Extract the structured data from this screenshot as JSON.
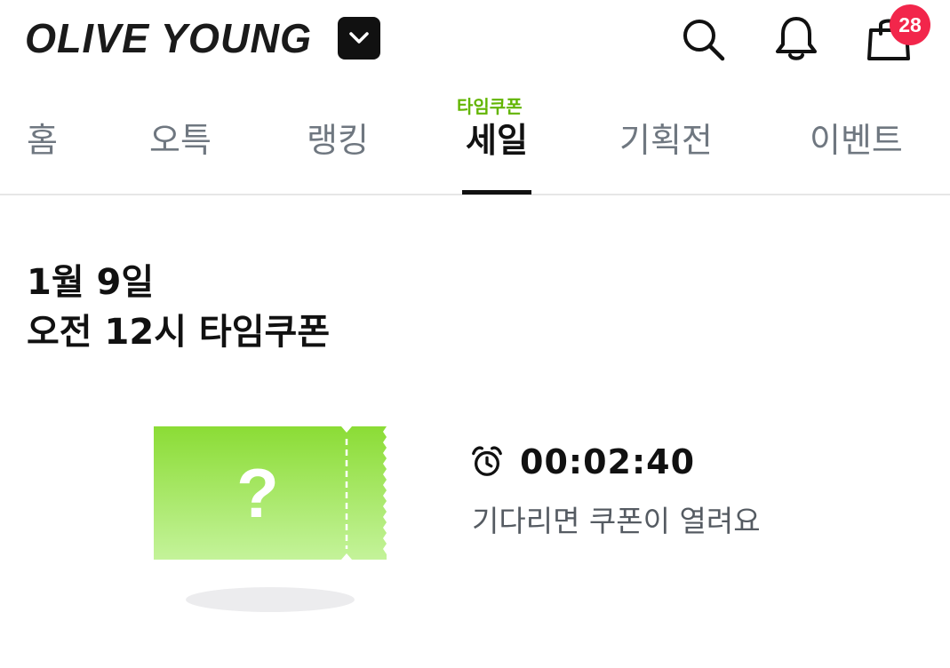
{
  "header": {
    "logo_text": "OLIVE YOUNG",
    "cart_badge_count": "28",
    "icons": [
      "chevron-down-icon",
      "search-icon",
      "bell-icon",
      "shopping-bag-icon"
    ],
    "colors": {
      "badge": "#f2264b",
      "logo": "#1a1a1a"
    }
  },
  "tabs": {
    "items": [
      {
        "label": "홈"
      },
      {
        "label": "오특"
      },
      {
        "label": "랭킹"
      },
      {
        "label": "세일"
      },
      {
        "label": "기획전"
      },
      {
        "label": "이벤트"
      }
    ],
    "active_tab": "세일",
    "sale_tag": "타임쿠폰",
    "colors": {
      "tag": "#62b500",
      "inactive": "#6f7780",
      "active": "#111111"
    }
  },
  "coupon": {
    "title_line1": "1월 9일",
    "title_line2": "오전 12시 타임쿠폰",
    "ticket_symbol": "?",
    "timer_icon": "alarm-clock-icon",
    "timer": "00:02:40",
    "caption": "기다리면 쿠폰이 열려요",
    "colors": {
      "ticket_top": "#8bdc35",
      "ticket_bottom": "#c4f39a"
    }
  }
}
